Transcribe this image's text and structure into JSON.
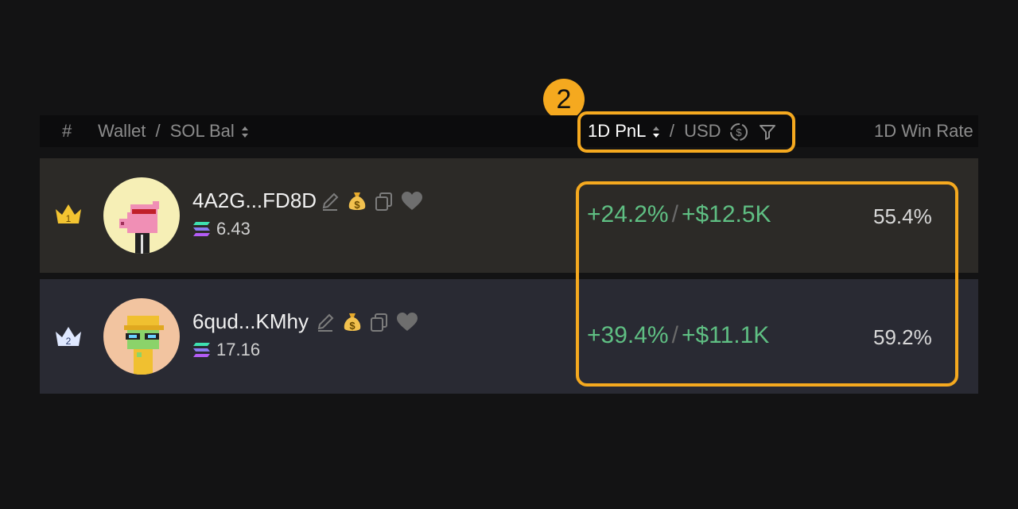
{
  "step_badge": "2",
  "header": {
    "rank": "#",
    "wallet": "Wallet",
    "slash": "/",
    "sol_bal": "SOL Bal",
    "pnl": "1D PnL",
    "usd": "USD",
    "win_rate": "1D Win Rate"
  },
  "rows": [
    {
      "rank": "1",
      "wallet": "4A2G...FD8D",
      "balance": "6.43",
      "pnl_pct": "+24.2%",
      "pnl_usd": "+$12.5K",
      "win_rate": "55.4%"
    },
    {
      "rank": "2",
      "wallet": "6qud...KMhy",
      "balance": "17.16",
      "pnl_pct": "+39.4%",
      "pnl_usd": "+$11.1K",
      "win_rate": "59.2%"
    }
  ],
  "separator": "/",
  "colors": {
    "highlight": "#f5a91f",
    "positive": "#5fbf83",
    "gold_crown": "#f3c431",
    "silver_crown": "#dfe8ff"
  },
  "icons": [
    "crown-icon",
    "edit-icon",
    "money-bag-icon",
    "copy-icon",
    "heart-icon",
    "solana-icon",
    "sort-icon",
    "usd-coin-icon",
    "filter-icon"
  ]
}
